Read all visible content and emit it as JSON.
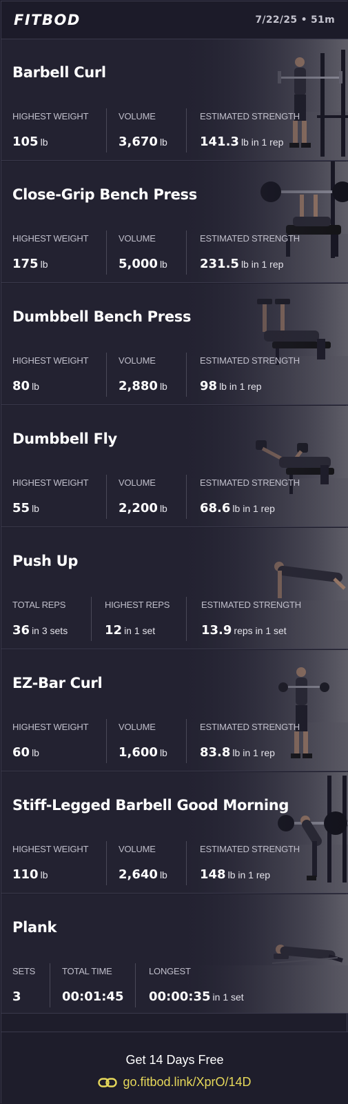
{
  "header": {
    "logo": "FITBOD",
    "datetime": "7/22/25 • 51m"
  },
  "exercises": [
    {
      "title": "Barbell Curl",
      "stats": [
        {
          "label": "HIGHEST WEIGHT",
          "value": "105",
          "unit": "lb"
        },
        {
          "label": "VOLUME",
          "value": "3,670",
          "unit": "lb"
        },
        {
          "label": "ESTIMATED STRENGTH",
          "value": "141.3",
          "unit": "lb in 1 rep"
        }
      ]
    },
    {
      "title": "Close-Grip Bench Press",
      "stats": [
        {
          "label": "HIGHEST WEIGHT",
          "value": "175",
          "unit": "lb"
        },
        {
          "label": "VOLUME",
          "value": "5,000",
          "unit": "lb"
        },
        {
          "label": "ESTIMATED STRENGTH",
          "value": "231.5",
          "unit": "lb in 1 rep"
        }
      ]
    },
    {
      "title": "Dumbbell Bench Press",
      "stats": [
        {
          "label": "HIGHEST WEIGHT",
          "value": "80",
          "unit": "lb"
        },
        {
          "label": "VOLUME",
          "value": "2,880",
          "unit": "lb"
        },
        {
          "label": "ESTIMATED STRENGTH",
          "value": "98",
          "unit": "lb in 1 rep"
        }
      ]
    },
    {
      "title": "Dumbbell Fly",
      "stats": [
        {
          "label": "HIGHEST WEIGHT",
          "value": "55",
          "unit": "lb"
        },
        {
          "label": "VOLUME",
          "value": "2,200",
          "unit": "lb"
        },
        {
          "label": "ESTIMATED STRENGTH",
          "value": "68.6",
          "unit": "lb in 1 rep"
        }
      ]
    },
    {
      "title": "Push Up",
      "stats": [
        {
          "label": "TOTAL REPS",
          "value": "36",
          "unit": "in 3 sets"
        },
        {
          "label": "HIGHEST REPS",
          "value": "12",
          "unit": "in 1 set"
        },
        {
          "label": "ESTIMATED STRENGTH",
          "value": "13.9",
          "unit": "reps in 1 set"
        }
      ]
    },
    {
      "title": "EZ-Bar Curl",
      "stats": [
        {
          "label": "HIGHEST WEIGHT",
          "value": "60",
          "unit": "lb"
        },
        {
          "label": "VOLUME",
          "value": "1,600",
          "unit": "lb"
        },
        {
          "label": "ESTIMATED STRENGTH",
          "value": "83.8",
          "unit": "lb in 1 rep"
        }
      ]
    },
    {
      "title": "Stiff-Legged Barbell Good Morning",
      "stats": [
        {
          "label": "HIGHEST WEIGHT",
          "value": "110",
          "unit": "lb"
        },
        {
          "label": "VOLUME",
          "value": "2,640",
          "unit": "lb"
        },
        {
          "label": "ESTIMATED STRENGTH",
          "value": "148",
          "unit": "lb in 1 rep"
        }
      ]
    },
    {
      "title": "Plank",
      "stats": [
        {
          "label": "SETS",
          "value": "3",
          "unit": ""
        },
        {
          "label": "TOTAL TIME",
          "value": "00:01:45",
          "unit": ""
        },
        {
          "label": "LONGEST",
          "value": "00:00:35",
          "unit": "in 1 set"
        }
      ]
    }
  ],
  "footer": {
    "cta": "Get 14 Days Free",
    "link": "go.fitbod.link/XprO/14D"
  },
  "colors": {
    "background": "#1e1d2b",
    "card": "#232231",
    "link": "#e6d85a",
    "label": "#c0bfcb"
  }
}
